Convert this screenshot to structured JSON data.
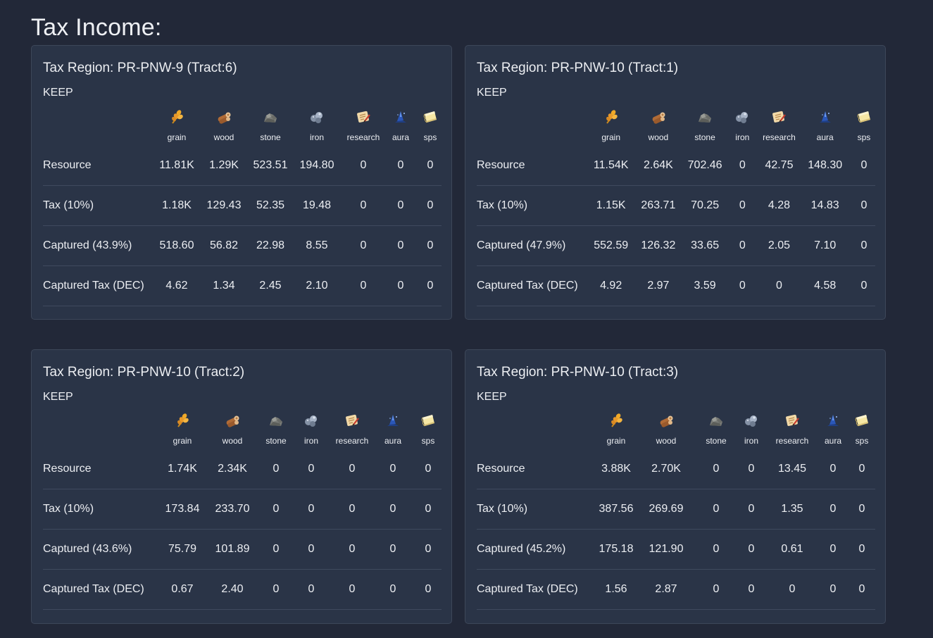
{
  "page": {
    "title": "Tax Income:"
  },
  "resource_columns": [
    {
      "key": "grain",
      "label": "grain",
      "icon": "grain-icon"
    },
    {
      "key": "wood",
      "label": "wood",
      "icon": "wood-icon"
    },
    {
      "key": "stone",
      "label": "stone",
      "icon": "stone-icon"
    },
    {
      "key": "iron",
      "label": "iron",
      "icon": "iron-icon"
    },
    {
      "key": "research",
      "label": "research",
      "icon": "research-icon"
    },
    {
      "key": "aura",
      "label": "aura",
      "icon": "aura-icon"
    },
    {
      "key": "sps",
      "label": "sps",
      "icon": "sps-icon"
    }
  ],
  "regions": [
    {
      "title": "Tax Region: PR-PNW-9 (Tract:6)",
      "subtitle": "KEEP",
      "rows": [
        {
          "label": "Resource",
          "values": [
            "11.81K",
            "1.29K",
            "523.51",
            "194.80",
            "0",
            "0",
            "0"
          ]
        },
        {
          "label": "Tax (10%)",
          "values": [
            "1.18K",
            "129.43",
            "52.35",
            "19.48",
            "0",
            "0",
            "0"
          ]
        },
        {
          "label": "Captured (43.9%)",
          "values": [
            "518.60",
            "56.82",
            "22.98",
            "8.55",
            "0",
            "0",
            "0"
          ]
        },
        {
          "label": "Captured Tax (DEC)",
          "values": [
            "4.62",
            "1.34",
            "2.45",
            "2.10",
            "0",
            "0",
            "0"
          ]
        }
      ]
    },
    {
      "title": "Tax Region: PR-PNW-10 (Tract:1)",
      "subtitle": "KEEP",
      "rows": [
        {
          "label": "Resource",
          "values": [
            "11.54K",
            "2.64K",
            "702.46",
            "0",
            "42.75",
            "148.30",
            "0"
          ]
        },
        {
          "label": "Tax (10%)",
          "values": [
            "1.15K",
            "263.71",
            "70.25",
            "0",
            "4.28",
            "14.83",
            "0"
          ]
        },
        {
          "label": "Captured (47.9%)",
          "values": [
            "552.59",
            "126.32",
            "33.65",
            "0",
            "2.05",
            "7.10",
            "0"
          ]
        },
        {
          "label": "Captured Tax (DEC)",
          "values": [
            "4.92",
            "2.97",
            "3.59",
            "0",
            "0",
            "4.58",
            "0"
          ]
        }
      ]
    },
    {
      "title": "Tax Region: PR-PNW-10 (Tract:2)",
      "subtitle": "KEEP",
      "rows": [
        {
          "label": "Resource",
          "values": [
            "1.74K",
            "2.34K",
            "0",
            "0",
            "0",
            "0",
            "0"
          ]
        },
        {
          "label": "Tax (10%)",
          "values": [
            "173.84",
            "233.70",
            "0",
            "0",
            "0",
            "0",
            "0"
          ]
        },
        {
          "label": "Captured (43.6%)",
          "values": [
            "75.79",
            "101.89",
            "0",
            "0",
            "0",
            "0",
            "0"
          ]
        },
        {
          "label": "Captured Tax (DEC)",
          "values": [
            "0.67",
            "2.40",
            "0",
            "0",
            "0",
            "0",
            "0"
          ]
        }
      ]
    },
    {
      "title": "Tax Region: PR-PNW-10 (Tract:3)",
      "subtitle": "KEEP",
      "rows": [
        {
          "label": "Resource",
          "values": [
            "3.88K",
            "2.70K",
            "0",
            "0",
            "13.45",
            "0",
            "0"
          ]
        },
        {
          "label": "Tax (10%)",
          "values": [
            "387.56",
            "269.69",
            "0",
            "0",
            "1.35",
            "0",
            "0"
          ]
        },
        {
          "label": "Captured (45.2%)",
          "values": [
            "175.18",
            "121.90",
            "0",
            "0",
            "0.61",
            "0",
            "0"
          ]
        },
        {
          "label": "Captured Tax (DEC)",
          "values": [
            "1.56",
            "2.87",
            "0",
            "0",
            "0",
            "0",
            "0"
          ]
        }
      ]
    }
  ],
  "colors": {
    "background": "#222838",
    "card": "#2a3447",
    "card_border": "#3d4759",
    "text": "#eceef2"
  }
}
